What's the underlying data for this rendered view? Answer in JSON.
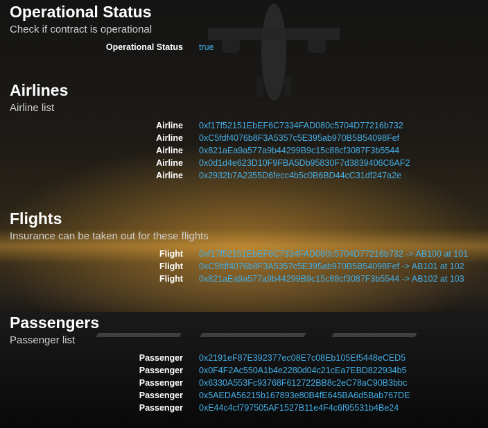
{
  "operational": {
    "title": "Operational Status",
    "subtitle": "Check if contract is operational",
    "rows": [
      {
        "label": "Operational Status",
        "value": "true"
      }
    ]
  },
  "airlines": {
    "title": "Airlines",
    "subtitle": "Airline list",
    "rows": [
      {
        "label": "Airline",
        "value": "0xf17f52151EbEF6C7334FAD080c5704D77216b732"
      },
      {
        "label": "Airline",
        "value": "0xC5fdf4076b8F3A5357c5E395ab970B5B54098Fef"
      },
      {
        "label": "Airline",
        "value": "0x821aEa9a577a9b44299B9c15c88cf3087F3b5544"
      },
      {
        "label": "Airline",
        "value": "0x0d1d4e623D10F9FBA5Db95830F7d3839406C6AF2"
      },
      {
        "label": "Airline",
        "value": "0x2932b7A2355D6fecc4b5c0B6BD44cC31df247a2e"
      }
    ]
  },
  "flights": {
    "title": "Flights",
    "subtitle": "Insurance can be taken out for these flights",
    "rows": [
      {
        "label": "Flight",
        "value": "0xf17f52151EbEF6C7334FAD080c5704D77216b732 -> AB100 at 101"
      },
      {
        "label": "Flight",
        "value": "0xC5fdf4076b8F3A5357c5E395ab970B5B54098Fef -> AB101 at 102"
      },
      {
        "label": "Flight",
        "value": "0x821aEa9a577a9b44299B9c15c88cf3087F3b5544 -> AB102 at 103"
      }
    ]
  },
  "passengers": {
    "title": "Passengers",
    "subtitle": "Passenger list",
    "rows": [
      {
        "label": "Passenger",
        "value": "0x2191eF87E392377ec08E7c08Eb105Ef5448eCED5"
      },
      {
        "label": "Passenger",
        "value": "0x0F4F2Ac550A1b4e2280d04c21cEa7EBD822934b5"
      },
      {
        "label": "Passenger",
        "value": "0x6330A553Fc93768F612722BB8c2eC78aC90B3bbc"
      },
      {
        "label": "Passenger",
        "value": "0x5AEDA56215b167893e80B4fE645BA6d5Bab767DE"
      },
      {
        "label": "Passenger",
        "value": "0xE44c4cf797505AF1527B11e4F4c6f95531b4Be24"
      }
    ]
  },
  "theme": {
    "value_color": "#44aee6",
    "label_color": "#ffffff",
    "subtitle_color": "#cfcfcf"
  }
}
